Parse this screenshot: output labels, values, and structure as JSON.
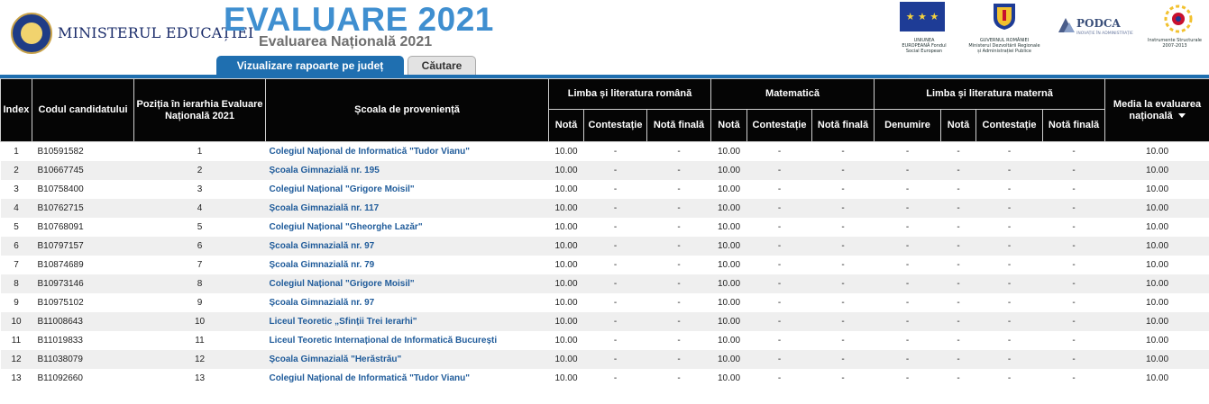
{
  "header": {
    "ministry": "MINISTERUL EDUCAȚIEI",
    "title": "EVALUARE 2021",
    "subtitle": "Evaluarea Națională 2021",
    "logos": {
      "eu_caption": "UNIUNEA EUROPEANĂ Fondul Social European",
      "gov_caption": "GUVERNUL ROMÂNIEI Ministerul Dezvoltării Regionale și Administrației Publice",
      "podca": "PODCA",
      "podca_tag": "INOVAȚIE ÎN ADMINISTRAȚIE",
      "is_caption": "Instrumente Structurale 2007-2013"
    }
  },
  "tabs": [
    {
      "label": "Vizualizare rapoarte pe județ",
      "active": true
    },
    {
      "label": "Căutare",
      "active": false
    }
  ],
  "table": {
    "headers": {
      "index": "Index",
      "code": "Codul candidatului",
      "position": "Poziția în ierarhia Evaluare Națională 2021",
      "school": "Școala de proveniență",
      "romana": "Limba și literatura română",
      "mate": "Matematică",
      "materna": "Limba și literatura maternă",
      "media": "Media la evaluarea națională",
      "nota": "Notă",
      "contestatie": "Contestație",
      "nota_finala": "Notă finală",
      "denumire": "Denumire"
    },
    "rows": [
      {
        "index": "1",
        "code": "B10591582",
        "pos": "1",
        "school": "Colegiul Național de Informatică \"Tudor Vianu\"",
        "rn": "10.00",
        "rc": "-",
        "rf": "-",
        "mn": "10.00",
        "mc": "-",
        "mf": "-",
        "ld": "-",
        "ln": "-",
        "lc": "-",
        "lf": "-",
        "media": "10.00"
      },
      {
        "index": "2",
        "code": "B10667745",
        "pos": "2",
        "school": "Școala Gimnazială nr. 195",
        "rn": "10.00",
        "rc": "-",
        "rf": "-",
        "mn": "10.00",
        "mc": "-",
        "mf": "-",
        "ld": "-",
        "ln": "-",
        "lc": "-",
        "lf": "-",
        "media": "10.00"
      },
      {
        "index": "3",
        "code": "B10758400",
        "pos": "3",
        "school": "Colegiul Național \"Grigore Moisil\"",
        "rn": "10.00",
        "rc": "-",
        "rf": "-",
        "mn": "10.00",
        "mc": "-",
        "mf": "-",
        "ld": "-",
        "ln": "-",
        "lc": "-",
        "lf": "-",
        "media": "10.00"
      },
      {
        "index": "4",
        "code": "B10762715",
        "pos": "4",
        "school": "Școala Gimnazială nr. 117",
        "rn": "10.00",
        "rc": "-",
        "rf": "-",
        "mn": "10.00",
        "mc": "-",
        "mf": "-",
        "ld": "-",
        "ln": "-",
        "lc": "-",
        "lf": "-",
        "media": "10.00"
      },
      {
        "index": "5",
        "code": "B10768091",
        "pos": "5",
        "school": "Colegiul Național \"Gheorghe Lazăr\"",
        "rn": "10.00",
        "rc": "-",
        "rf": "-",
        "mn": "10.00",
        "mc": "-",
        "mf": "-",
        "ld": "-",
        "ln": "-",
        "lc": "-",
        "lf": "-",
        "media": "10.00"
      },
      {
        "index": "6",
        "code": "B10797157",
        "pos": "6",
        "school": "Școala Gimnazială nr. 97",
        "rn": "10.00",
        "rc": "-",
        "rf": "-",
        "mn": "10.00",
        "mc": "-",
        "mf": "-",
        "ld": "-",
        "ln": "-",
        "lc": "-",
        "lf": "-",
        "media": "10.00"
      },
      {
        "index": "7",
        "code": "B10874689",
        "pos": "7",
        "school": "Școala Gimnazială nr. 79",
        "rn": "10.00",
        "rc": "-",
        "rf": "-",
        "mn": "10.00",
        "mc": "-",
        "mf": "-",
        "ld": "-",
        "ln": "-",
        "lc": "-",
        "lf": "-",
        "media": "10.00"
      },
      {
        "index": "8",
        "code": "B10973146",
        "pos": "8",
        "school": "Colegiul Național \"Grigore Moisil\"",
        "rn": "10.00",
        "rc": "-",
        "rf": "-",
        "mn": "10.00",
        "mc": "-",
        "mf": "-",
        "ld": "-",
        "ln": "-",
        "lc": "-",
        "lf": "-",
        "media": "10.00"
      },
      {
        "index": "9",
        "code": "B10975102",
        "pos": "9",
        "school": "Școala Gimnazială nr. 97",
        "rn": "10.00",
        "rc": "-",
        "rf": "-",
        "mn": "10.00",
        "mc": "-",
        "mf": "-",
        "ld": "-",
        "ln": "-",
        "lc": "-",
        "lf": "-",
        "media": "10.00"
      },
      {
        "index": "10",
        "code": "B11008643",
        "pos": "10",
        "school": "Liceul Teoretic „Sfinții Trei Ierarhi\"",
        "rn": "10.00",
        "rc": "-",
        "rf": "-",
        "mn": "10.00",
        "mc": "-",
        "mf": "-",
        "ld": "-",
        "ln": "-",
        "lc": "-",
        "lf": "-",
        "media": "10.00"
      },
      {
        "index": "11",
        "code": "B11019833",
        "pos": "11",
        "school": "Liceul Teoretic Internațional de Informatică București",
        "rn": "10.00",
        "rc": "-",
        "rf": "-",
        "mn": "10.00",
        "mc": "-",
        "mf": "-",
        "ld": "-",
        "ln": "-",
        "lc": "-",
        "lf": "-",
        "media": "10.00"
      },
      {
        "index": "12",
        "code": "B11038079",
        "pos": "12",
        "school": "Școala Gimnazială \"Herăstrău\"",
        "rn": "10.00",
        "rc": "-",
        "rf": "-",
        "mn": "10.00",
        "mc": "-",
        "mf": "-",
        "ld": "-",
        "ln": "-",
        "lc": "-",
        "lf": "-",
        "media": "10.00"
      },
      {
        "index": "13",
        "code": "B11092660",
        "pos": "13",
        "school": "Colegiul Național de Informatică \"Tudor Vianu\"",
        "rn": "10.00",
        "rc": "-",
        "rf": "-",
        "mn": "10.00",
        "mc": "-",
        "mf": "-",
        "ld": "-",
        "ln": "-",
        "lc": "-",
        "lf": "-",
        "media": "10.00"
      }
    ]
  }
}
